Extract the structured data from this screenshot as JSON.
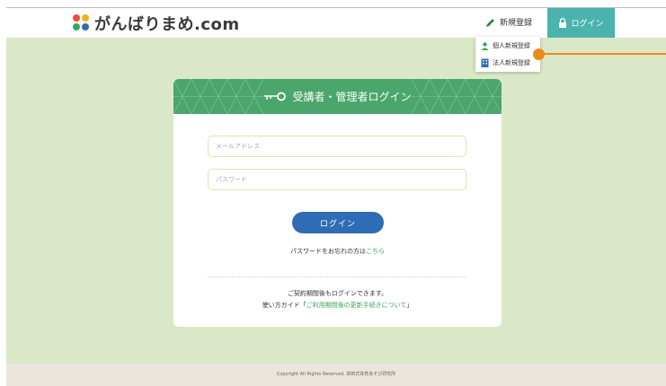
{
  "header": {
    "logo_text": "がんばりまめ",
    "logo_suffix": ".com",
    "register_label": "新規登録",
    "login_label": "ログイン"
  },
  "dropdown": {
    "items": [
      {
        "label": "個人新規登録",
        "icon": "person-icon"
      },
      {
        "label": "法人新規登録",
        "icon": "building-icon"
      }
    ]
  },
  "card": {
    "title": "受講者・管理者ログイン",
    "email_placeholder": "メールアドレス",
    "password_placeholder": "パスワード",
    "login_button": "ログイン",
    "forgot_text": "パスワードをお忘れの方は",
    "forgot_link": "こちら",
    "note_line1": "ご契約期間後もログインできます。",
    "note_line2_prefix": "使い方ガイド「",
    "note_line2_link": "ご利用期間後の更新手続きについて",
    "note_line2_suffix": "」"
  },
  "footer": {
    "copyright": "Copyright All Rights Reserved. 栄田式体育あそび研究所"
  },
  "colors": {
    "brand_green": "#4aa66a",
    "login_teal": "#4bb3ad",
    "button_blue": "#2e6db4",
    "callout_orange": "#ee8a1a",
    "page_bg": "#dbe8c8"
  }
}
